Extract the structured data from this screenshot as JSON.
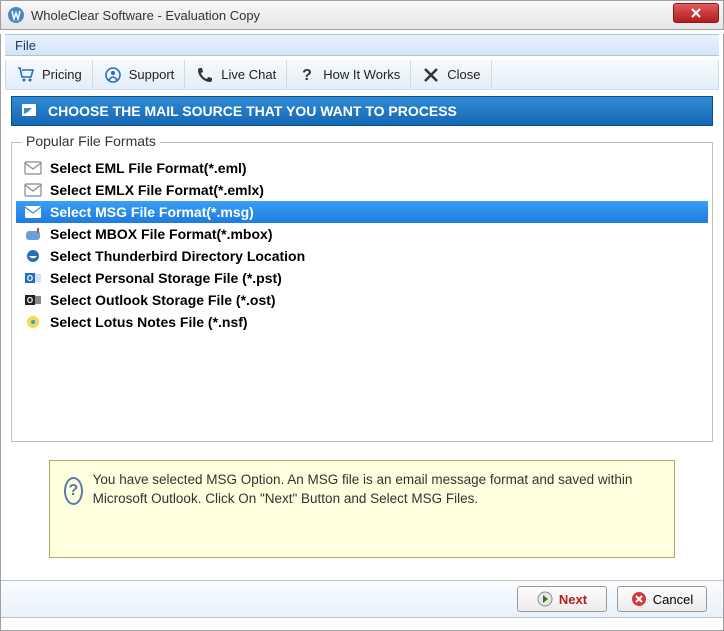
{
  "window": {
    "title": "WholeClear Software - Evaluation Copy"
  },
  "menubar": {
    "file": "File"
  },
  "toolbar": {
    "pricing": {
      "label": "Pricing"
    },
    "support": {
      "label": "Support"
    },
    "livechat": {
      "label": "Live Chat"
    },
    "how": {
      "label": "How It Works"
    },
    "close": {
      "label": "Close"
    }
  },
  "banner": {
    "text": "CHOOSE THE MAIL SOURCE THAT YOU WANT TO PROCESS"
  },
  "group": {
    "legend": "Popular File Formats"
  },
  "formats": [
    {
      "label": "Select EML File Format(*.eml)",
      "selected": false
    },
    {
      "label": "Select EMLX File Format(*.emlx)",
      "selected": false
    },
    {
      "label": "Select MSG File Format(*.msg)",
      "selected": true
    },
    {
      "label": "Select MBOX File Format(*.mbox)",
      "selected": false
    },
    {
      "label": "Select Thunderbird Directory Location",
      "selected": false
    },
    {
      "label": "Select Personal Storage File (*.pst)",
      "selected": false
    },
    {
      "label": "Select Outlook Storage File (*.ost)",
      "selected": false
    },
    {
      "label": "Select Lotus Notes File (*.nsf)",
      "selected": false
    }
  ],
  "info": {
    "text": "You have selected MSG Option. An MSG file is an email message format and saved within Microsoft Outlook. Click On \"Next\" Button and Select MSG Files."
  },
  "buttons": {
    "next": "Next",
    "cancel": "Cancel"
  }
}
